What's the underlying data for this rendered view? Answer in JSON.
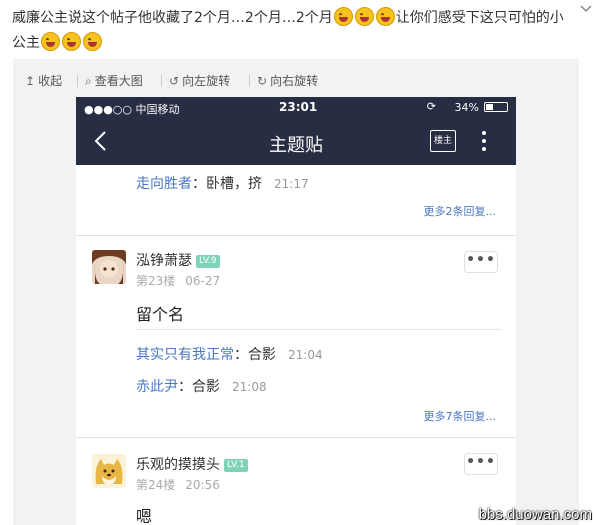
{
  "post": {
    "text_part1": "威廉公主说这个帖子他收藏了2个月…2个月…2个月",
    "text_part2": "让你们感受下这只可怕的小公主"
  },
  "emoji_name": "laughing-tears-emoji",
  "toolbar": {
    "collapse": "收起",
    "view_large": "查看大图",
    "rotate_left": "向左旋转",
    "rotate_right": "向右旋转"
  },
  "phone": {
    "status": {
      "carrier": "●●●○○ 中国移动",
      "time": "23:01",
      "battery": "34%",
      "battery_level": 0.34
    },
    "nav": {
      "title": "主题贴",
      "op_only": "楼主"
    },
    "top_reply": {
      "name": "走向胜者",
      "text": "：卧槽，挤",
      "time": "21:17"
    },
    "more_top": "更多2条回复...",
    "floor23": {
      "user": "泓铮萧瑟",
      "level": "LV.9",
      "floor": "第23楼",
      "date": "06-27",
      "content": "留个名",
      "replies": [
        {
          "name": "其实只有我正常",
          "text": "：合影",
          "time": "21:04"
        },
        {
          "name": "赤此尹",
          "text": "：合影",
          "time": "21:08"
        }
      ],
      "more": "更多7条回复..."
    },
    "floor24": {
      "user": "乐观的摸摸头",
      "level": "LV.1",
      "floor": "第24楼",
      "date": "20:56",
      "content": "嗯"
    }
  },
  "watermark": "bbs.duowan.com"
}
